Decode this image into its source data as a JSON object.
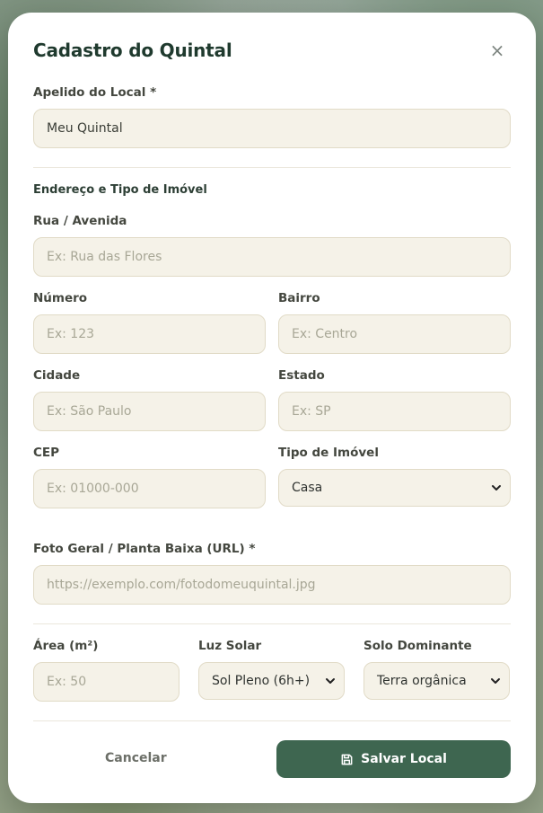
{
  "dialog": {
    "title": "Cadastro do Quintal",
    "close_label": "×"
  },
  "fields": {
    "nickname": {
      "label": "Apelido do Local *",
      "value": "Meu Quintal",
      "placeholder": ""
    },
    "address_section": "Endereço e Tipo de Imóvel",
    "street": {
      "label": "Rua / Avenida",
      "placeholder": "Ex: Rua das Flores"
    },
    "number": {
      "label": "Número",
      "placeholder": "Ex: 123"
    },
    "neighborhood": {
      "label": "Bairro",
      "placeholder": "Ex: Centro"
    },
    "city": {
      "label": "Cidade",
      "placeholder": "Ex: São Paulo"
    },
    "state": {
      "label": "Estado",
      "placeholder": "Ex: SP"
    },
    "zip": {
      "label": "CEP",
      "placeholder": "Ex: 01000-000"
    },
    "property_type": {
      "label": "Tipo de Imóvel",
      "selected": "Casa"
    },
    "photo_url": {
      "label": "Foto Geral / Planta Baixa (URL) *",
      "placeholder": "https://exemplo.com/fotodomeuquintal.jpg"
    },
    "area": {
      "label": "Área (m²)",
      "placeholder": "Ex: 50"
    },
    "sunlight": {
      "label": "Luz Solar",
      "selected": "Sol Pleno (6h+)"
    },
    "soil": {
      "label": "Solo Dominante",
      "selected": "Terra orgânica"
    }
  },
  "footer": {
    "cancel_label": "Cancelar",
    "save_label": "Salvar Local"
  },
  "colors": {
    "primary": "#3e6650",
    "input_bg": "#f5f2e8",
    "title": "#1f3a2e"
  },
  "icons": {
    "close": "close-icon",
    "save": "save-icon",
    "dropdown": "chevron-down-icon"
  }
}
